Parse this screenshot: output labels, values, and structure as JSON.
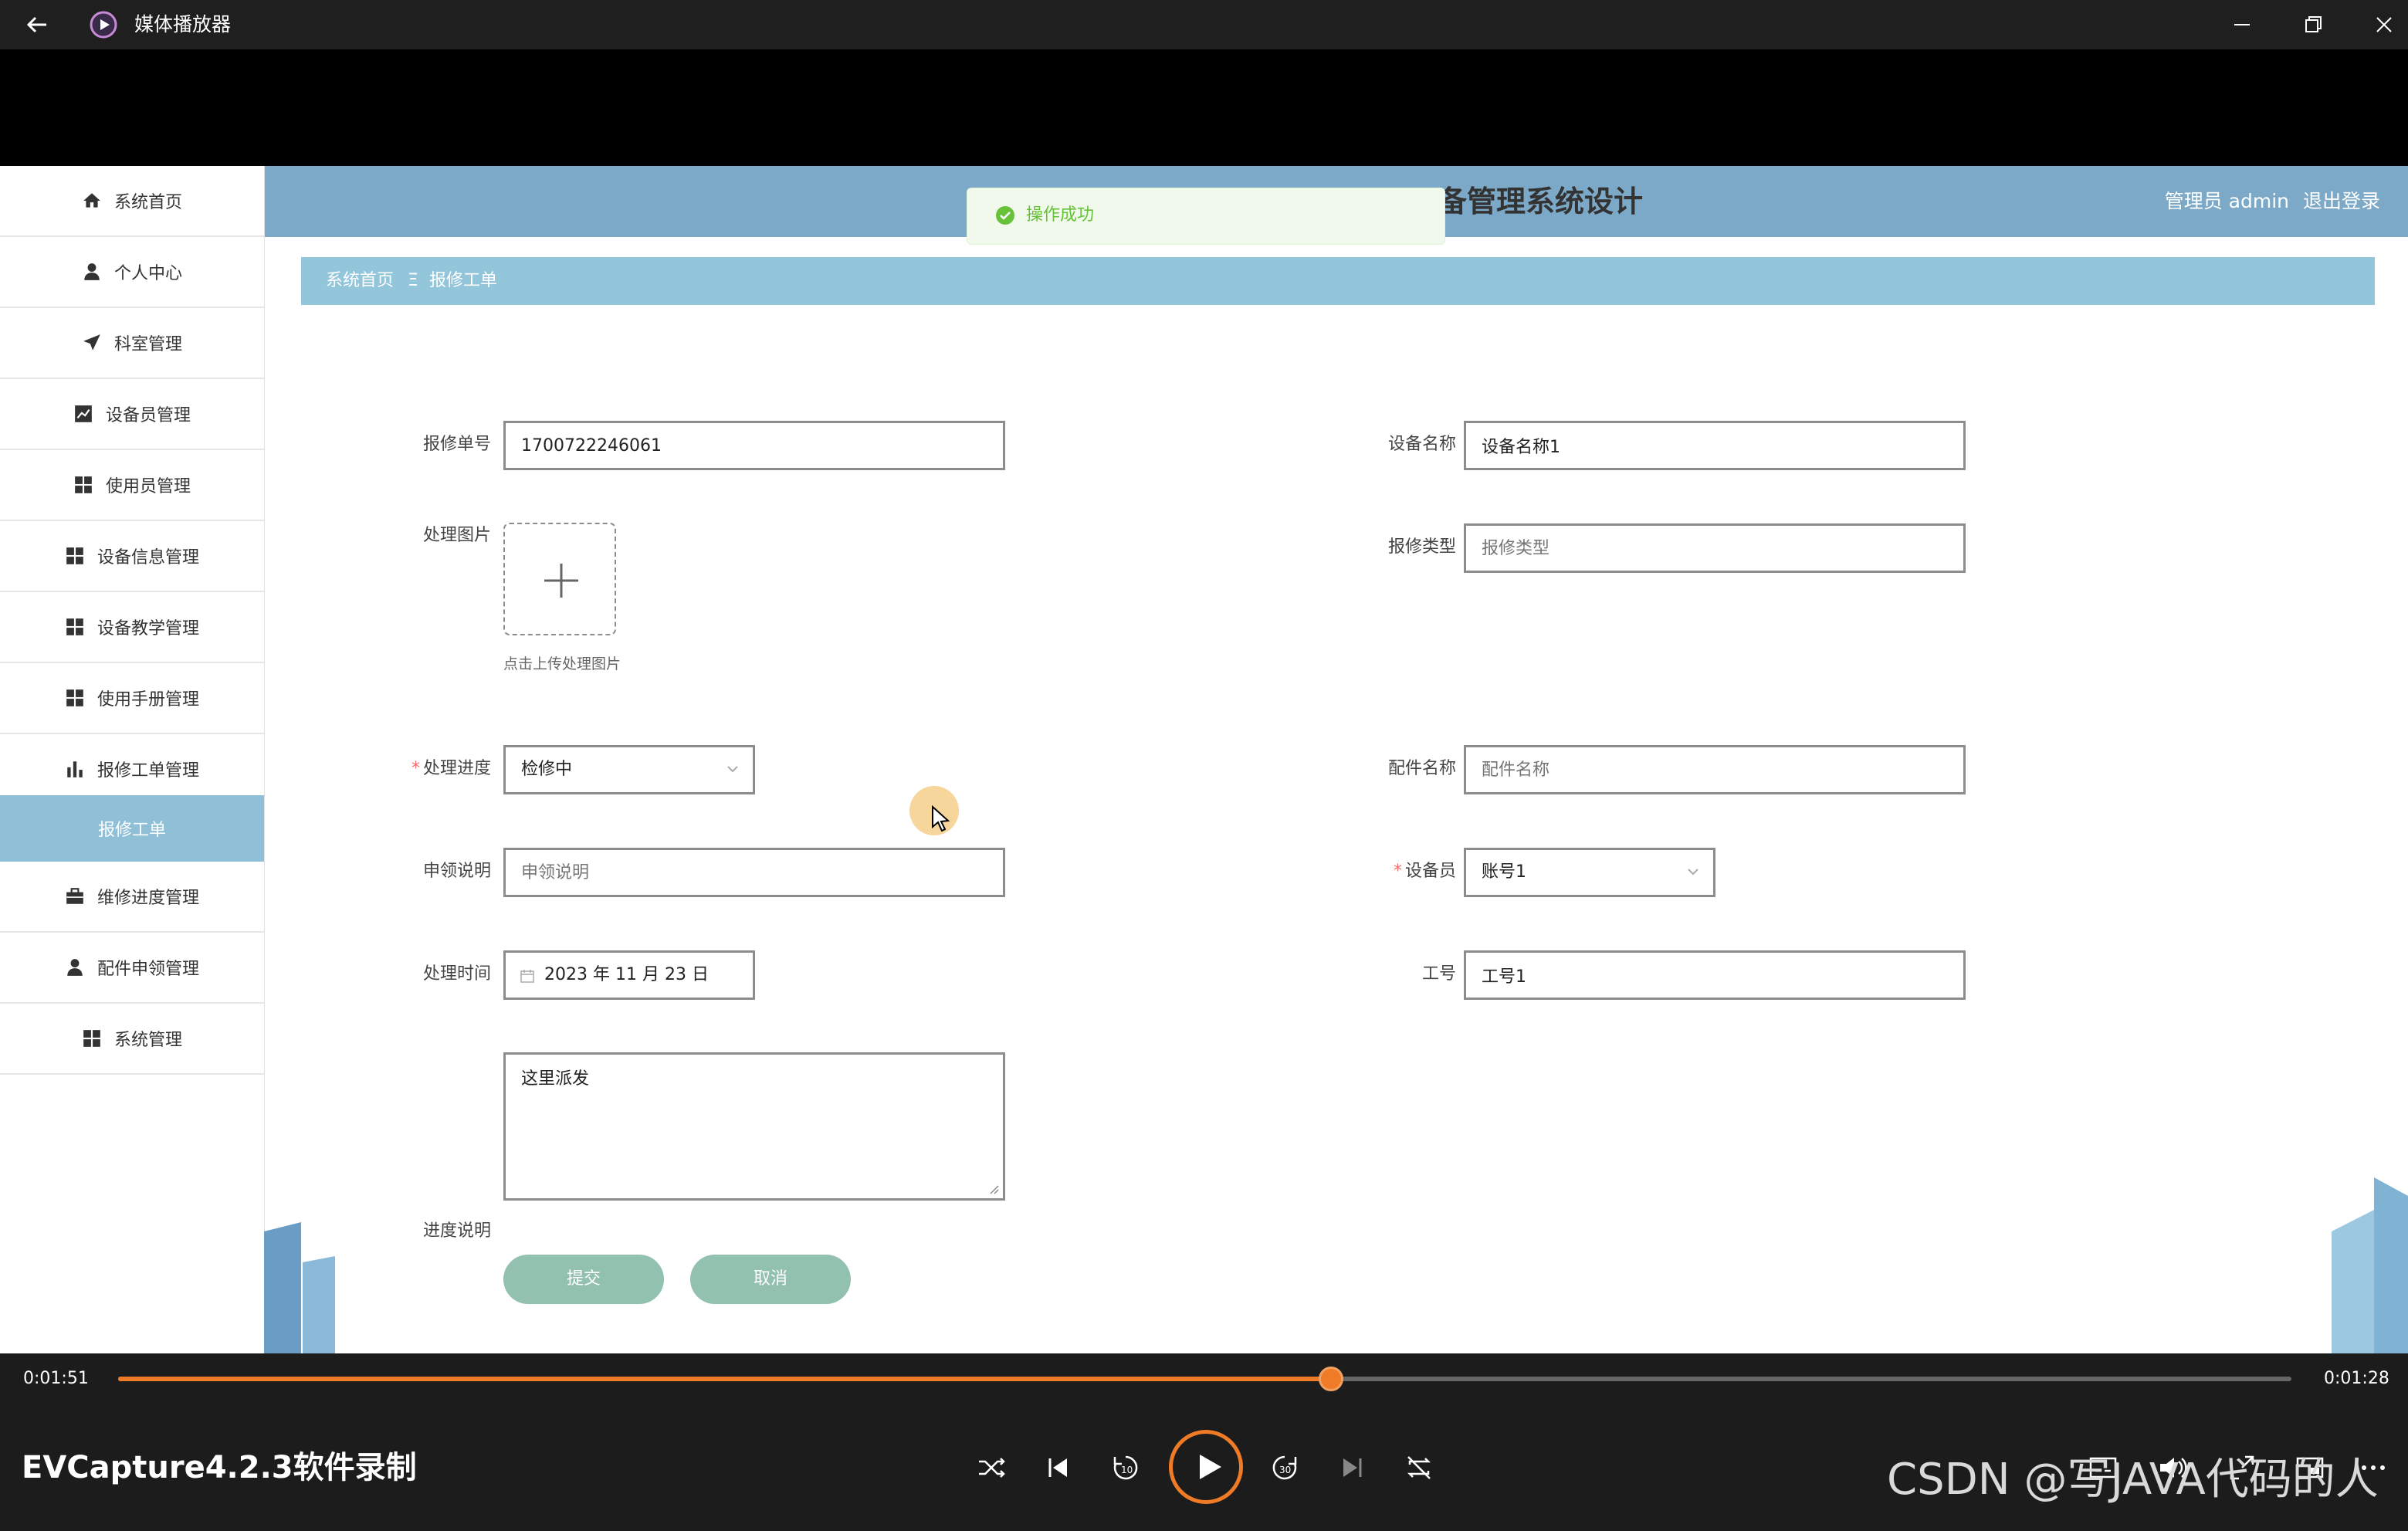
{
  "window": {
    "title": "媒体播放器"
  },
  "header": {
    "system_title": "备管理系统设计",
    "user_label": "管理员 admin",
    "logout": "退出登录"
  },
  "toast": {
    "text": "操作成功"
  },
  "breadcrumb": {
    "home": "系统首页",
    "sep": "Ξ",
    "current": "报修工单"
  },
  "sidebar": {
    "items": [
      {
        "label": "系统首页",
        "icon": "home-icon"
      },
      {
        "label": "个人中心",
        "icon": "user-icon"
      },
      {
        "label": "科室管理",
        "icon": "send-icon"
      },
      {
        "label": "设备员管理",
        "icon": "chart-icon"
      },
      {
        "label": "使用员管理",
        "icon": "grid-icon"
      },
      {
        "label": "设备信息管理",
        "icon": "grid-icon"
      },
      {
        "label": "设备教学管理",
        "icon": "grid-icon"
      },
      {
        "label": "使用手册管理",
        "icon": "grid-icon"
      },
      {
        "label": "报修工单管理",
        "icon": "bar-chart-icon"
      }
    ],
    "active_sub": "报修工单",
    "items_after": [
      {
        "label": "维修进度管理",
        "icon": "briefcase-icon"
      },
      {
        "label": "配件申领管理",
        "icon": "user-icon"
      },
      {
        "label": "系统管理",
        "icon": "grid-icon"
      }
    ]
  },
  "form": {
    "repair_no": {
      "label": "报修单号",
      "value": "1700722246061"
    },
    "device_name": {
      "label": "设备名称",
      "value": "设备名称1"
    },
    "process_image": {
      "label": "处理图片",
      "hint": "点击上传处理图片"
    },
    "repair_type": {
      "label": "报修类型",
      "placeholder": "报修类型"
    },
    "progress": {
      "label": "处理进度",
      "value": "检修中"
    },
    "part_name": {
      "label": "配件名称",
      "placeholder": "配件名称"
    },
    "apply_desc": {
      "label": "申领说明",
      "placeholder": "申领说明"
    },
    "device_staff": {
      "label": "设备员",
      "value": "账号1"
    },
    "process_time": {
      "label": "处理时间",
      "value": "2023 年 11 月 23 日"
    },
    "job_no": {
      "label": "工号",
      "value": "工号1"
    },
    "progress_desc": {
      "label": "进度说明",
      "value": "这里派发"
    },
    "submit": "提交",
    "cancel": "取消"
  },
  "player": {
    "elapsed": "0:01:51",
    "remaining": "0:01:28",
    "progress_fraction": 0.558,
    "recorder_text": "EVCapture4.2.3软件录制",
    "watermark": "CSDN @写JAVA代码的人",
    "accent": "#ef7b26"
  }
}
